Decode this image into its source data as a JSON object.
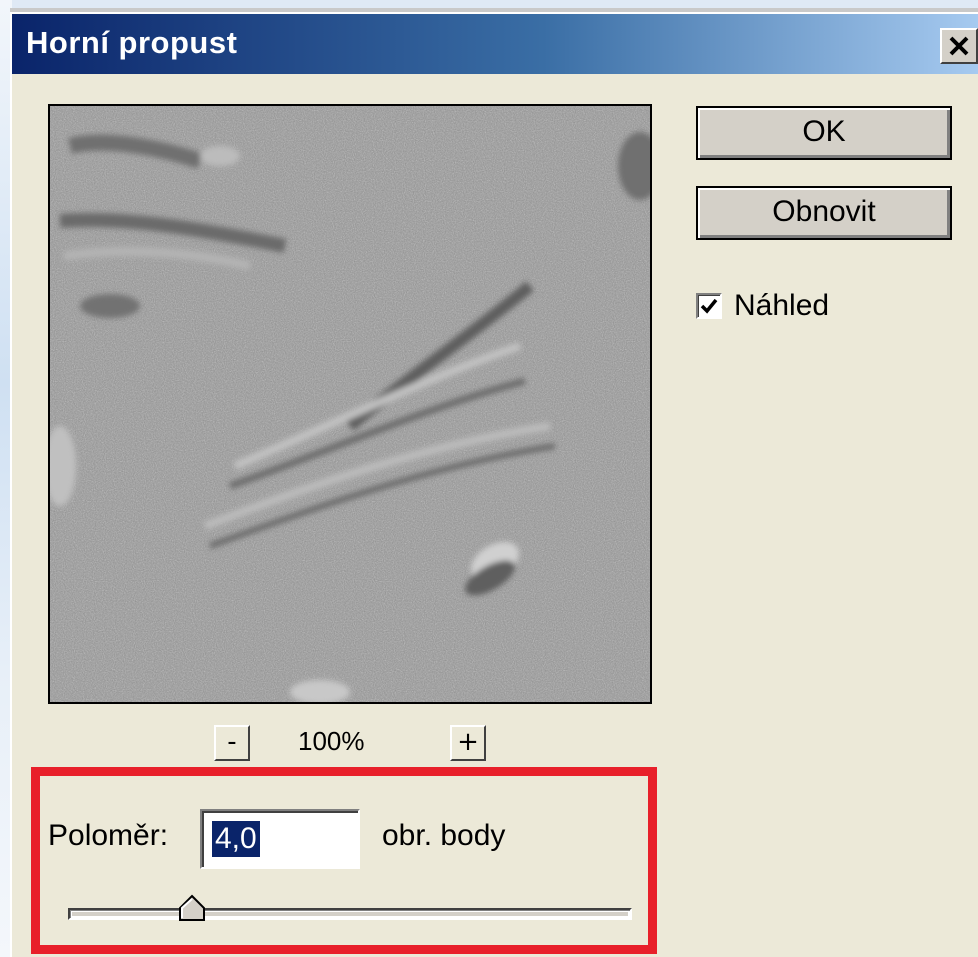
{
  "window": {
    "title": "Horní propust",
    "close_label": "×"
  },
  "preview": {
    "zoom_out_label": "-",
    "zoom_in_label": "+",
    "zoom_level": "100%"
  },
  "buttons": {
    "ok_label": "OK",
    "reset_label": "Obnovit"
  },
  "preview_toggle": {
    "label": "Náhled",
    "checked": true
  },
  "radius": {
    "label": "Poloměr:",
    "value": "4,0",
    "unit": "obr. body",
    "slider_fraction": 0.22
  },
  "colors": {
    "title_bar_start": "#0a246a",
    "title_bar_end": "#a6caf0",
    "selection": "#0a246a",
    "highlight_frame": "#e8202a",
    "dialog_background": "#ece9d8"
  },
  "icons": {
    "close": "close-icon",
    "checkbox_mark": "checkmark-icon",
    "slider_thumb": "triangle-thumb-icon"
  }
}
